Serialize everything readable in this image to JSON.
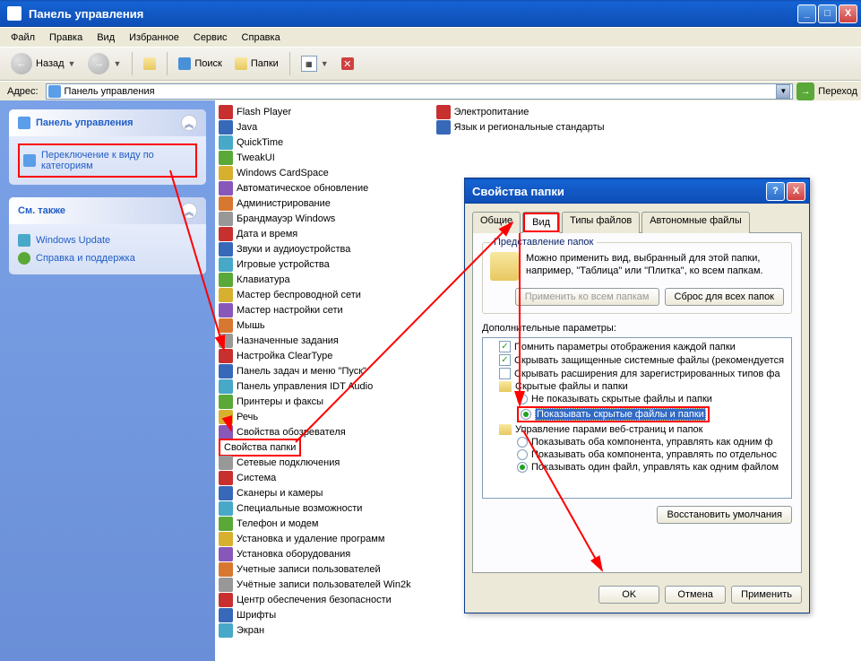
{
  "window": {
    "title": "Панель управления",
    "minimize": "_",
    "maximize": "□",
    "close": "X"
  },
  "menu": [
    "Файл",
    "Правка",
    "Вид",
    "Избранное",
    "Сервис",
    "Справка"
  ],
  "toolbar": {
    "back": "Назад",
    "search": "Поиск",
    "folders": "Папки"
  },
  "address": {
    "label": "Адрес:",
    "value": "Панель управления",
    "go": "Переход"
  },
  "sidebar": {
    "panel1": {
      "title": "Панель управления",
      "link1": "Переключение к виду по категориям"
    },
    "panel2": {
      "title": "См. также",
      "link1": "Windows Update",
      "link2": "Справка и поддержка"
    }
  },
  "cpitems_col1": [
    "Flash Player",
    "Java",
    "QuickTime",
    "TweakUI",
    "Windows CardSpace",
    "Автоматическое обновление",
    "Администрирование",
    "Брандмауэр Windows",
    "Дата и время",
    "Звуки и аудиоустройства",
    "Игровые устройства",
    "Клавиатура",
    "Мастер беспроводной сети",
    "Мастер настройки сети",
    "Мышь",
    "Назначенные задания",
    "Настройка ClearType",
    "Панель задач и меню \"Пуск\"",
    "Панель управления IDT Audio",
    "Принтеры и факсы",
    "Речь",
    "Свойства обозревателя",
    "Свойства папки",
    "Сетевые подключения",
    "Система",
    "Сканеры и камеры",
    "Специальные возможности",
    "Телефон и модем",
    "Установка и удаление программ",
    "Установка оборудования",
    "Учетные записи пользователей",
    "Учётные записи пользователей Win2k",
    "Центр обеспечения безопасности",
    "Шрифты",
    "Экран"
  ],
  "cpitems_col2": [
    "Электропитание",
    "Язык и региональные стандарты"
  ],
  "dialog": {
    "title": "Свойства папки",
    "tabs": [
      "Общие",
      "Вид",
      "Типы файлов",
      "Автономные файлы"
    ],
    "group_title": "Представление папок",
    "group_text": "Можно применить вид, выбранный для этой папки, например, \"Таблица\" или \"Плитка\", ко всем папкам.",
    "btn_apply_all": "Применить ко всем папкам",
    "btn_reset_all": "Сброс для всех папок",
    "adv_label": "Дополнительные параметры:",
    "tree": [
      {
        "type": "chk",
        "checked": true,
        "indent": 0,
        "text": "Помнить параметры отображения каждой папки"
      },
      {
        "type": "chk",
        "checked": true,
        "indent": 0,
        "text": "Скрывать защищенные системные файлы (рекомендуется"
      },
      {
        "type": "chk",
        "checked": false,
        "indent": 0,
        "text": "Скрывать расширения для зарегистрированных типов фа"
      },
      {
        "type": "folder",
        "indent": 0,
        "text": "Скрытые файлы и папки"
      },
      {
        "type": "rad",
        "checked": false,
        "indent": 1,
        "text": "Не показывать скрытые файлы и папки"
      },
      {
        "type": "rad",
        "checked": true,
        "indent": 1,
        "text": "Показывать скрытые файлы и папки",
        "selected": true
      },
      {
        "type": "folder",
        "indent": 0,
        "text": "Управление парами веб-страниц и папок"
      },
      {
        "type": "rad",
        "checked": false,
        "indent": 1,
        "text": "Показывать оба компонента, управлять как одним ф"
      },
      {
        "type": "rad",
        "checked": false,
        "indent": 1,
        "text": "Показывать оба компонента, управлять по отдельнос"
      },
      {
        "type": "rad",
        "checked": true,
        "indent": 1,
        "text": "Показывать один файл, управлять как одним файлом"
      }
    ],
    "btn_restore": "Восстановить умолчания",
    "btn_ok": "OK",
    "btn_cancel": "Отмена",
    "btn_apply": "Применить"
  }
}
